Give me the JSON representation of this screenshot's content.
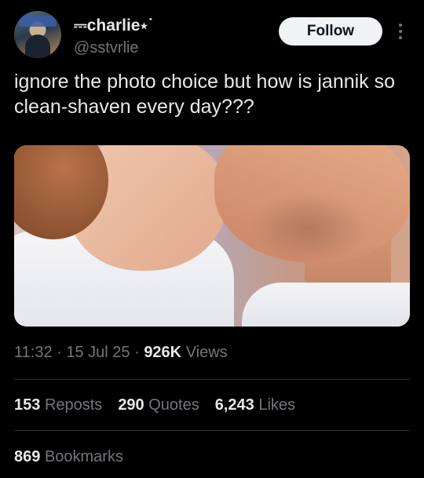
{
  "author": {
    "display_name": "⎓charlie⋆˙",
    "handle": "@sstvrlie"
  },
  "follow_label": "Follow",
  "tweet": {
    "text": "ignore the photo choice but how is jannik so clean-shaven every day???"
  },
  "meta": {
    "time": "11:32",
    "date": "15 Jul 25",
    "views_count": "926K",
    "views_label": "Views"
  },
  "stats": {
    "reposts_count": "153",
    "reposts_label": "Reposts",
    "quotes_count": "290",
    "quotes_label": "Quotes",
    "likes_count": "6,243",
    "likes_label": "Likes",
    "bookmarks_count": "869",
    "bookmarks_label": "Bookmarks"
  },
  "colors": {
    "background": "#000000",
    "text": "#e7e9ea",
    "secondary": "#71767b",
    "follow_bg": "#eff3f4"
  },
  "icons": [
    "more-options-icon"
  ]
}
